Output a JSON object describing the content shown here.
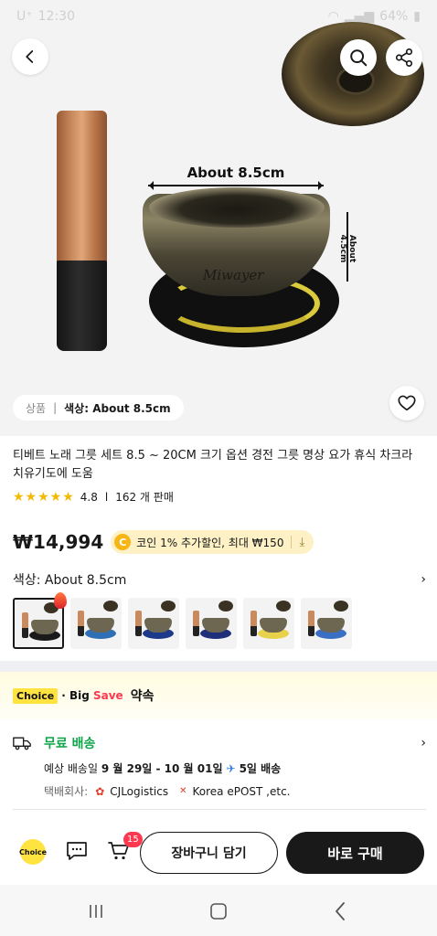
{
  "status_bar": {
    "carrier": "U⁺",
    "time": "12:30",
    "battery": "64%"
  },
  "hero": {
    "dimension_width": "About  8.5cm",
    "dimension_height": "About 4.5cm",
    "brand_mark": "Miwayer",
    "variant_pill": {
      "prefix": "상품",
      "separator": "|",
      "label": "색상: About 8.5cm"
    }
  },
  "product": {
    "title": "티베트 노래 그릇 세트 8.5 ~ 20CM 크기 옵션 경전 그릇 명상 요가 휴식 차크라 치유기도에 도움",
    "rating_value": "4.8",
    "rating_separator": "l",
    "sold_count": "162 개 판매",
    "stars": 5,
    "price": "₩14,994",
    "coin_chip": "코인 1% 추가할인, 최대 ₩150"
  },
  "color_option": {
    "label": "색상: About 8.5cm",
    "swatches": [
      {
        "cushion_color": "#1a1a1a",
        "selected": true
      },
      {
        "cushion_color": "#2f6fb5",
        "selected": false
      },
      {
        "cushion_color": "#1d3a8a",
        "selected": false
      },
      {
        "cushion_color": "#1f2f7a",
        "selected": false
      },
      {
        "cushion_color": "#e8d24a",
        "selected": false
      },
      {
        "cushion_color": "#3a6fc4",
        "selected": false
      }
    ]
  },
  "choice_banner": {
    "tag": "Choice",
    "big": "· Big ",
    "save": "Save",
    "promise": "약속"
  },
  "shipping": {
    "free_label": "무료 배송",
    "eta_prefix": "예상 배송일",
    "eta_range": "9 월 29일 - 10 월 01일",
    "eta_days": "5일 배송",
    "carrier_label": "택배회사:",
    "carrier_1": "CJLogistics",
    "carrier_2": "Korea ePOST ,etc."
  },
  "action_bar": {
    "choice_label": "Choice",
    "cart_count": "15",
    "add_to_cart": "장바구니 담기",
    "buy_now": "바로 구매"
  },
  "colors": {
    "accent_green": "#10a54a",
    "choice_yellow": "#ffe340",
    "badge_red": "#fd384f",
    "star": "#f5b800"
  }
}
